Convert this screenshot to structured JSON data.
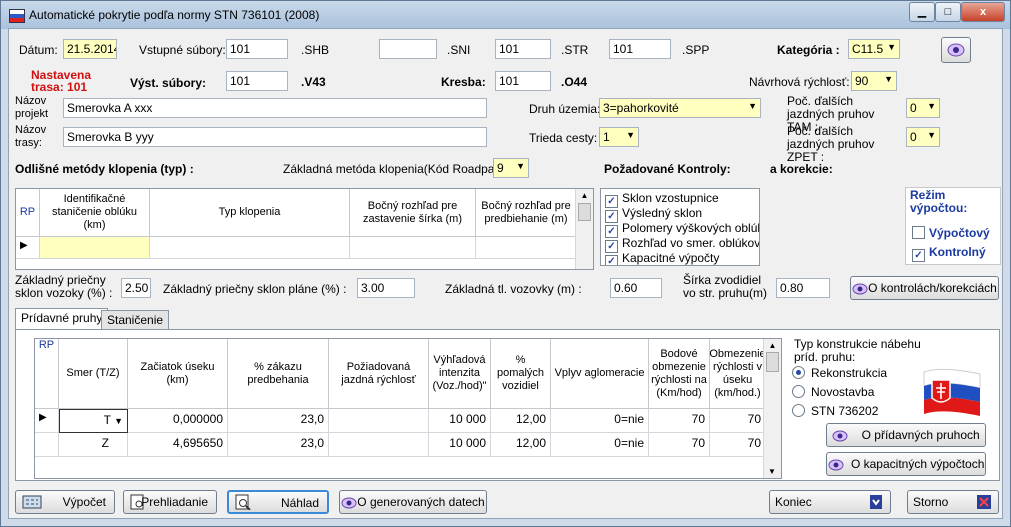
{
  "window": {
    "title": "Automatické pokrytie podľa normy STN 736101 (2008)",
    "min": "▁",
    "max": "□",
    "close": "x"
  },
  "header": {
    "datum_label": "Dátum:",
    "datum_value": "21.5.2014",
    "vstupne_label": "Vstupné súbory:",
    "vstupne_shb": "101",
    "ext_shb": ".SHB",
    "sni_value": "",
    "ext_sni": ".SNI",
    "str_value": "101",
    "ext_str": ".STR",
    "spp_value": "101",
    "ext_spp": ".SPP",
    "kategoria_label": "Kategória :",
    "kategoria_value": "C11.5",
    "nastavena_label": "Nastavena trasa: 101",
    "vyst_label": "Výst. súbory:",
    "vyst_value": "101",
    "ext_v43": ".V43",
    "kresba_label": "Kresba:",
    "kresba_value": "101",
    "ext_o44": ".O44",
    "navrhova_label": "Návrhová rýchlosť:",
    "navrhova_value": "90",
    "nazov_projekt_label": "Názov projekt",
    "nazov_projekt_value": "Smerovka A  xxx",
    "nazov_trasy_label": "Názov trasy:",
    "nazov_trasy_value": "Smerovka B yyy",
    "druh_label": "Druh územia:",
    "druh_value": "3=pahorkovité",
    "trieda_label": "Trieda cesty:",
    "trieda_value": "1",
    "poc_tam_label": "Poč. ďalších jazdných pruhov TAM :",
    "poc_tam_value": "0",
    "poc_zpet_label": "Poč. ďalších jazdných pruhov ZPET :",
    "poc_zpet_value": "0"
  },
  "klopenie": {
    "title": "Odlišné metódy klopenia (typ)  :",
    "zakladna_label": "Základná metóda klopenia(Kód Roadpac):",
    "zakladna_value": "9",
    "columns": [
      "RP",
      "Identifikačné staničenie oblúku (km)",
      "Typ klopenia",
      "Bočný rozhľad pre zastavenie šírka (m)",
      "Bočný rozhľad pre predbiehanie (m)"
    ]
  },
  "kontroly": {
    "title": "Požadované Kontroly:",
    "korekcie": "a korekcie:",
    "items": [
      "Sklon vzostupnice",
      "Výsledný  sklon",
      "Polomery výškových oblúkov",
      "Rozhľad vo smer.  oblúkov",
      "Kapacitné výpočty"
    ]
  },
  "rezim": {
    "title": "Režim výpočtou:",
    "vypoctovy": "Výpočtový",
    "kontrolny": "Kontrolný"
  },
  "params": {
    "priecny_label": "Základný priečny sklon vozoky (%) :",
    "priecny_value": "2.50",
    "plane_label": "Základný priečny sklon pláne (%) :",
    "plane_value": "3.00",
    "tl_label": "Základná tl. vozovky (m) :",
    "tl_value": "0.60",
    "sirka_label": "Šírka zvodidiel vo str. pruhu(m)",
    "sirka_value": "0.80",
    "kontrolach_button": "O kontrolách/korekciách"
  },
  "tabs": [
    "Prídavné pruhy",
    "Staničenie"
  ],
  "pruhy": {
    "columns": [
      "RP",
      "Smer (T/Z)",
      "Začiatok úseku (km)",
      "% zákazu predbehania",
      "Požiadovaná jazdná rýchlosť",
      "Výhľadová intenzita (Voz./hod)\"",
      "% pomalých vozidiel",
      "Vplyv aglomeracie",
      "Bodové obmezenie rýchlosti na (Km/hod)",
      "Obmezenie rýchlosti v úseku (km/hod.)"
    ],
    "rows": [
      [
        "T",
        "0,000000",
        "23,0",
        "",
        "10 000",
        "12,00",
        "0=nie",
        "70",
        "70"
      ],
      [
        "Z",
        "4,695650",
        "23,0",
        "",
        "10 000",
        "12,00",
        "0=nie",
        "70",
        "70"
      ]
    ]
  },
  "konstrukcia": {
    "title": "Typ konstrukcie nábehu príd. pruhu:",
    "options": [
      "Rekonstrukcia",
      "Novostavba",
      "STN  736202"
    ],
    "pridavnych_button": "O přídavných pruhoch",
    "kapacitnych_button": "O kapacitných výpočtoch"
  },
  "footer": {
    "vypocet": "Výpočet",
    "prehliadanie": "Prehliadanie",
    "nahlad": "Náhlad",
    "generovanych": "O generovaných datech",
    "koniec": "Koniec",
    "storno": "Storno"
  },
  "colors": {
    "yellow_field": "#ffffc0",
    "accent_blue": "#1b3aa0",
    "alert_red": "#d01010"
  }
}
